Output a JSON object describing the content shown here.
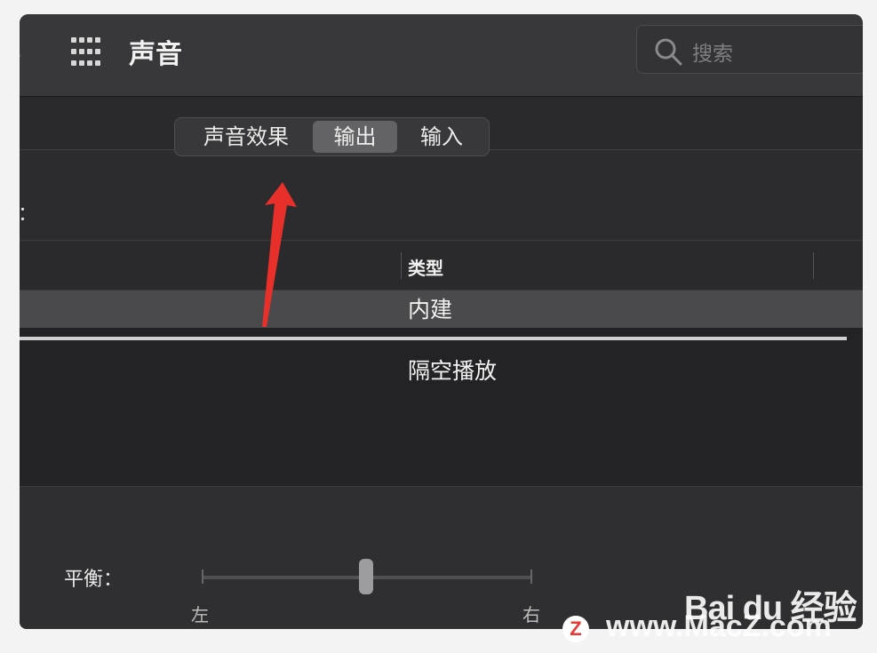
{
  "window": {
    "title": "声音"
  },
  "search": {
    "placeholder": "搜索"
  },
  "tabs": [
    {
      "label": "声音效果",
      "selected": false
    },
    {
      "label": "输出",
      "selected": true
    },
    {
      "label": "输入",
      "selected": false
    }
  ],
  "section_label_fragment": "：",
  "table": {
    "columns": [
      "类型"
    ],
    "rows": [
      {
        "type": "内建",
        "selected": true
      },
      {
        "type": "隔空播放",
        "selected": false
      }
    ]
  },
  "balance": {
    "label": "平衡：",
    "left": "左",
    "right": "右",
    "value": 0.5
  },
  "watermark": {
    "baidu": "Bai du 经验",
    "url": "www.MacZ.com",
    "logo_letter": "Z"
  },
  "colors": {
    "accent_arrow": "#e8302a",
    "selected_row": "#4a4a4c",
    "selected_tab": "#636366"
  },
  "icons": [
    "grid-icon",
    "search-icon",
    "annotation-arrow"
  ]
}
